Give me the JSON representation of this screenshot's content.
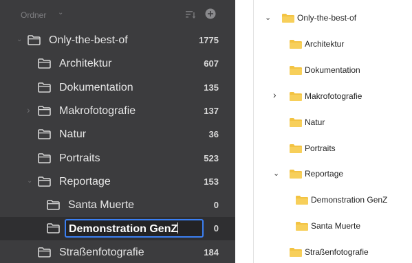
{
  "dark_panel": {
    "header": {
      "title": "Ordner"
    },
    "rows": [
      {
        "label": "Only-the-best-of",
        "count": "1775",
        "chevron": "expanded",
        "level": 0
      },
      {
        "label": "Architektur",
        "count": "607",
        "chevron": "none",
        "level": 1
      },
      {
        "label": "Dokumentation",
        "count": "135",
        "chevron": "none",
        "level": 1
      },
      {
        "label": "Makrofotografie",
        "count": "137",
        "chevron": "collapsed",
        "level": 1
      },
      {
        "label": "Natur",
        "count": "36",
        "chevron": "none",
        "level": 1
      },
      {
        "label": "Portraits",
        "count": "523",
        "chevron": "none",
        "level": 1
      },
      {
        "label": "Reportage",
        "count": "153",
        "chevron": "expanded",
        "level": 1
      },
      {
        "label": "Santa Muerte",
        "count": "0",
        "chevron": "none",
        "level": 2
      },
      {
        "label": "Demonstration GenZ",
        "count": "0",
        "chevron": "none",
        "level": 2,
        "editing": true
      },
      {
        "label": "Straßenfotografie",
        "count": "184",
        "chevron": "none",
        "level": 1
      }
    ]
  },
  "light_panel": {
    "rows": [
      {
        "label": "Only-the-best-of",
        "chevron": "expanded",
        "level": 0
      },
      {
        "label": "Architektur",
        "chevron": "none",
        "level": 1
      },
      {
        "label": "Dokumentation",
        "chevron": "none",
        "level": 1
      },
      {
        "label": "Makrofotografie",
        "chevron": "collapsed",
        "level": 1
      },
      {
        "label": "Natur",
        "chevron": "none",
        "level": 1
      },
      {
        "label": "Portraits",
        "chevron": "none",
        "level": 1
      },
      {
        "label": "Reportage",
        "chevron": "expanded",
        "level": 1
      },
      {
        "label": "Demonstration GenZ",
        "chevron": "none",
        "level": 2
      },
      {
        "label": "Santa Muerte",
        "chevron": "none",
        "level": 2
      },
      {
        "label": "Straßenfotografie",
        "chevron": "none",
        "level": 1
      }
    ]
  },
  "icons": {
    "dark_folder": "folder-outline-icon",
    "light_folder": "folder-yellow-icon",
    "sort": "sort-icon",
    "add": "add-circle-icon"
  },
  "colors": {
    "dark_bg": "#3c3c3e",
    "selection_bg": "#2f2f31",
    "edit_border": "#3b7ff2",
    "folder_yellow": "#f5c342"
  }
}
